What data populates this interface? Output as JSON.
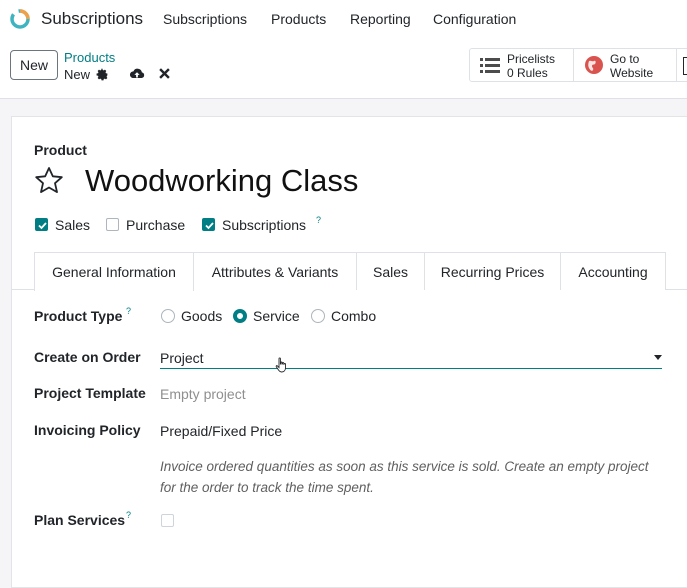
{
  "navbar": {
    "app_name": "Subscriptions",
    "menus": [
      "Subscriptions",
      "Products",
      "Reporting",
      "Configuration"
    ]
  },
  "control": {
    "new_label": "New",
    "breadcrumb_parent": "Products",
    "breadcrumb_current": "New",
    "stat_buttons": [
      {
        "line1": "Pricelists",
        "line2": "0 Rules",
        "icon": "list-icon"
      },
      {
        "line1": "Go to",
        "line2": "Website",
        "icon": "globe-icon"
      }
    ]
  },
  "form": {
    "product_label": "Product",
    "product_name": "Woodworking Class",
    "checkboxes": [
      {
        "label": "Sales",
        "checked": true
      },
      {
        "label": "Purchase",
        "checked": false
      },
      {
        "label": "Subscriptions",
        "checked": true,
        "help": "?"
      }
    ],
    "tabs": [
      "General Information",
      "Attributes & Variants",
      "Sales",
      "Recurring Prices",
      "Accounting"
    ],
    "active_tab": "General Information",
    "fields": {
      "product_type": {
        "label": "Product Type",
        "help": "?",
        "options": [
          "Goods",
          "Service",
          "Combo"
        ],
        "selected": "Service"
      },
      "create_on_order": {
        "label": "Create on Order",
        "value": "Project"
      },
      "project_template": {
        "label": "Project Template",
        "placeholder": "Empty project"
      },
      "invoicing_policy": {
        "label": "Invoicing Policy",
        "value": "Prepaid/Fixed Price",
        "hint": "Invoice ordered quantities as soon as this service is sold. Create an empty project for the order to track the time spent."
      },
      "plan_services": {
        "label": "Plan Services",
        "help": "?",
        "checked": false
      }
    }
  },
  "colors": {
    "accent": "#017e84",
    "background": "#f5f5f7"
  }
}
